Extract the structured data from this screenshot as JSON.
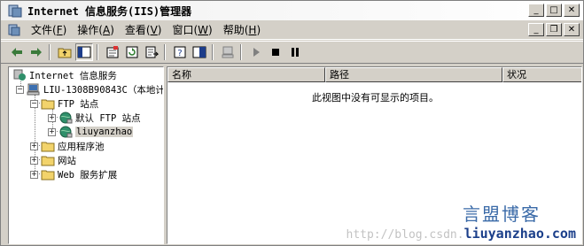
{
  "window": {
    "title": "Internet 信息服务(IIS)管理器",
    "controls": [
      "_",
      "□",
      "✕"
    ]
  },
  "menubar": {
    "items": [
      {
        "text": "文件(",
        "acc": "F",
        "end": ")"
      },
      {
        "text": "操作(",
        "acc": "A",
        "end": ")"
      },
      {
        "text": "查看(",
        "acc": "V",
        "end": ")"
      },
      {
        "text": "窗口(",
        "acc": "W",
        "end": ")"
      },
      {
        "text": "帮助(",
        "acc": "H",
        "end": ")"
      }
    ],
    "doc_controls": [
      "_",
      "❐",
      "✕"
    ]
  },
  "tree": {
    "root": "Internet 信息服务",
    "server": "LIU-1308B90843C（本地计",
    "ftp_sites": "FTP 站点",
    "default_ftp": "默认 FTP 站点",
    "liuyanzhao": "liuyanzhao",
    "app_pools": "应用程序池",
    "websites": "网站",
    "web_ext": "Web 服务扩展"
  },
  "list": {
    "columns": [
      "名称",
      "路径",
      "状况"
    ],
    "empty_message": "此视图中没有可显示的项目。"
  },
  "watermark": {
    "brand": "言盟博客",
    "url_prefix": "http://blog.csdn.",
    "url_bold": "liuyanzhao.com"
  },
  "colors": {
    "chrome": "#d4d0c8",
    "pane": "#ffffff",
    "folder": "#f2d36b",
    "globe": "#2f8f6a"
  },
  "icons": [
    "app-icon",
    "back-arrow-icon",
    "forward-arrow-icon",
    "up-folder-icon",
    "show-tree-icon",
    "properties-icon",
    "refresh-icon",
    "export-list-icon",
    "help-icon",
    "console-tree-icon",
    "computer-icon",
    "play-icon",
    "stop-icon",
    "pause-icon",
    "folder-icon",
    "globe-icon"
  ]
}
